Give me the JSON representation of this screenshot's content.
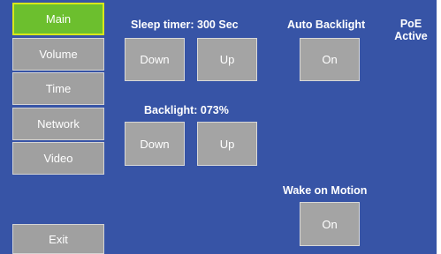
{
  "sidebar": {
    "tabs": [
      {
        "label": "Main",
        "active": true
      },
      {
        "label": "Volume",
        "active": false
      },
      {
        "label": "Time",
        "active": false
      },
      {
        "label": "Network",
        "active": false
      },
      {
        "label": "Video",
        "active": false
      }
    ],
    "exit_label": "Exit"
  },
  "sleep_timer": {
    "label": "Sleep timer: 300 Sec",
    "down_label": "Down",
    "up_label": "Up"
  },
  "backlight": {
    "label": "Backlight: 073%",
    "down_label": "Down",
    "up_label": "Up"
  },
  "auto_backlight": {
    "label": "Auto Backlight",
    "button_label": "On"
  },
  "wake_on_motion": {
    "label": "Wake on Motion",
    "button_label": "On"
  },
  "poe_status": {
    "line1": "PoE",
    "line2": "Active"
  },
  "colors": {
    "background": "#3754a6",
    "active_tab": "#6cbf2e",
    "button": "#a4a4a4",
    "text": "#ffffff"
  }
}
